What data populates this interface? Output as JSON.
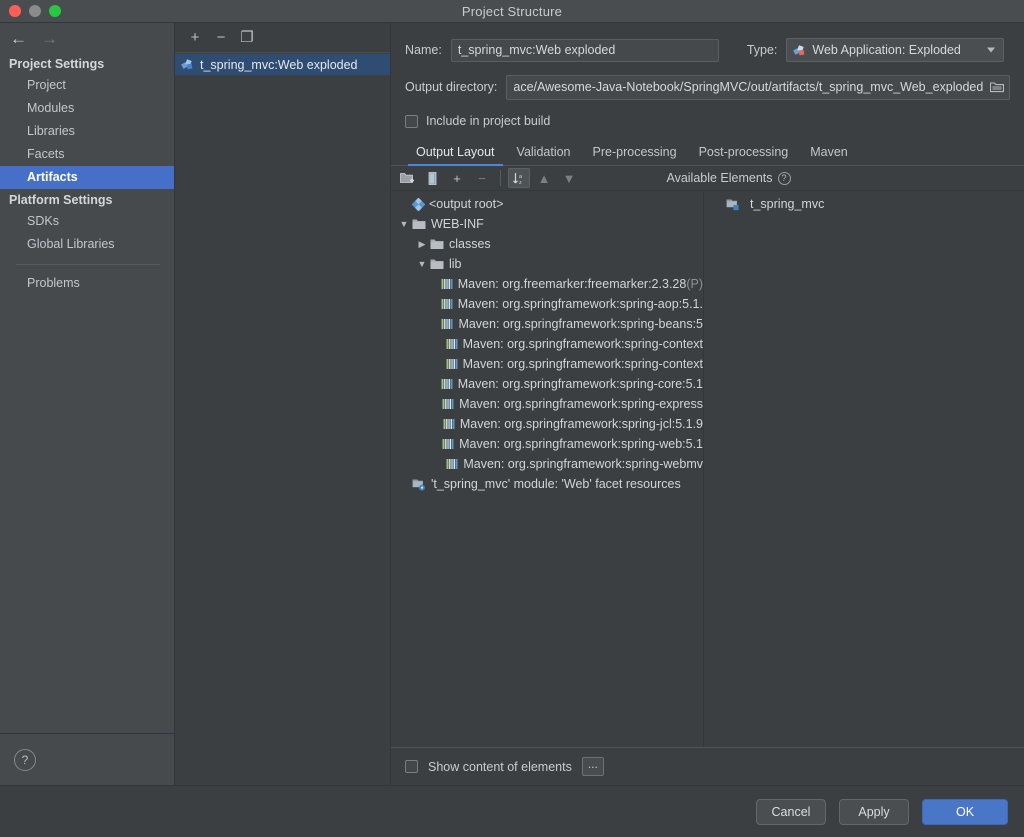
{
  "window": {
    "title": "Project Structure"
  },
  "traffic": {
    "close": "close-button",
    "minimize": "minimize-button",
    "zoom": "zoom-button"
  },
  "sidebar": {
    "back_arrow": "←",
    "forward_arrow": "→",
    "groups": [
      {
        "title": "Project Settings",
        "items": [
          {
            "label": "Project",
            "selected": false
          },
          {
            "label": "Modules",
            "selected": false
          },
          {
            "label": "Libraries",
            "selected": false
          },
          {
            "label": "Facets",
            "selected": false
          },
          {
            "label": "Artifacts",
            "selected": true
          }
        ]
      },
      {
        "title": "Platform Settings",
        "items": [
          {
            "label": "SDKs",
            "selected": false
          },
          {
            "label": "Global Libraries",
            "selected": false
          }
        ]
      }
    ],
    "problems": {
      "label": "Problems"
    },
    "help_label": "?"
  },
  "artifacts_panel": {
    "toolbar": [
      {
        "name": "add-artifact-button",
        "glyph": "+"
      },
      {
        "name": "remove-artifact-button",
        "glyph": "−"
      },
      {
        "name": "copy-artifact-button",
        "glyph": "❐"
      }
    ],
    "items": [
      {
        "label": "t_spring_mvc:Web exploded",
        "selected": true
      }
    ]
  },
  "detail": {
    "name_label": "Name:",
    "name_value": "t_spring_mvc:Web exploded",
    "type_label": "Type:",
    "type_value": "Web Application: Exploded",
    "output_dir_label": "Output directory:",
    "output_dir_value": "ace/Awesome-Java-Notebook/SpringMVC/out/artifacts/t_spring_mvc_Web_exploded",
    "include_in_build_label": "Include in project build",
    "include_in_build_checked": false,
    "tabs": [
      {
        "label": "Output Layout",
        "active": true
      },
      {
        "label": "Validation",
        "active": false
      },
      {
        "label": "Pre-processing",
        "active": false
      },
      {
        "label": "Post-processing",
        "active": false
      },
      {
        "label": "Maven",
        "active": false
      }
    ],
    "layout_toolbar": [
      {
        "name": "add-directory-button",
        "glyph": "▣"
      },
      {
        "name": "add-archive-button",
        "glyph": "▤"
      },
      {
        "name": "add-copy-button",
        "glyph": "+"
      },
      {
        "name": "remove-element-button",
        "glyph": "−"
      },
      {
        "name": "sort-button",
        "glyph": "⇅"
      },
      {
        "name": "move-up-button",
        "glyph": "▲"
      },
      {
        "name": "move-down-button",
        "glyph": "▼"
      }
    ],
    "available_elements_label": "Available Elements",
    "available_help_glyph": "?",
    "tree": [
      {
        "indent": 0,
        "twisty": "",
        "icon": "output-root-icon",
        "label": "<output root>",
        "suffix": ""
      },
      {
        "indent": 0,
        "twisty": "▼",
        "icon": "folder-icon",
        "label": "WEB-INF",
        "suffix": ""
      },
      {
        "indent": 1,
        "twisty": "▶",
        "icon": "folder-icon",
        "label": "classes",
        "suffix": ""
      },
      {
        "indent": 1,
        "twisty": "▼",
        "icon": "folder-icon",
        "label": "lib",
        "suffix": ""
      },
      {
        "indent": 2,
        "twisty": "",
        "icon": "jar-icon",
        "label": "Maven: org.freemarker:freemarker:2.3.28",
        "suffix": " (P)"
      },
      {
        "indent": 2,
        "twisty": "",
        "icon": "jar-icon",
        "label": "Maven: org.springframework:spring-aop:5.1.",
        "suffix": ""
      },
      {
        "indent": 2,
        "twisty": "",
        "icon": "jar-icon",
        "label": "Maven: org.springframework:spring-beans:5",
        "suffix": ""
      },
      {
        "indent": 2,
        "twisty": "",
        "icon": "jar-icon",
        "label": "Maven: org.springframework:spring-context",
        "suffix": ""
      },
      {
        "indent": 2,
        "twisty": "",
        "icon": "jar-icon",
        "label": "Maven: org.springframework:spring-context",
        "suffix": ""
      },
      {
        "indent": 2,
        "twisty": "",
        "icon": "jar-icon",
        "label": "Maven: org.springframework:spring-core:5.1",
        "suffix": ""
      },
      {
        "indent": 2,
        "twisty": "",
        "icon": "jar-icon",
        "label": "Maven: org.springframework:spring-express",
        "suffix": ""
      },
      {
        "indent": 2,
        "twisty": "",
        "icon": "jar-icon",
        "label": "Maven: org.springframework:spring-jcl:5.1.9",
        "suffix": ""
      },
      {
        "indent": 2,
        "twisty": "",
        "icon": "jar-icon",
        "label": "Maven: org.springframework:spring-web:5.1",
        "suffix": ""
      },
      {
        "indent": 2,
        "twisty": "",
        "icon": "jar-icon",
        "label": "Maven: org.springframework:spring-webmv",
        "suffix": ""
      },
      {
        "indent": 0,
        "twisty": "",
        "icon": "module-facet-icon",
        "label": "'t_spring_mvc' module: 'Web' facet resources",
        "suffix": ""
      }
    ],
    "available": [
      {
        "icon": "artifact-module-icon",
        "label": "t_spring_mvc"
      }
    ],
    "show_content_label": "Show content of elements",
    "show_content_checked": false,
    "ellipsis_label": "..."
  },
  "footer": {
    "cancel": "Cancel",
    "apply": "Apply",
    "ok": "OK"
  },
  "colors": {
    "accent_blue": "#4670c8",
    "tab_underline": "#4a88d8",
    "selection_unfocused": "#2f4c72",
    "window_bg": "#3c3f41",
    "sidebar_bg": "#464a4d",
    "primary_button": "#4a76c8"
  }
}
